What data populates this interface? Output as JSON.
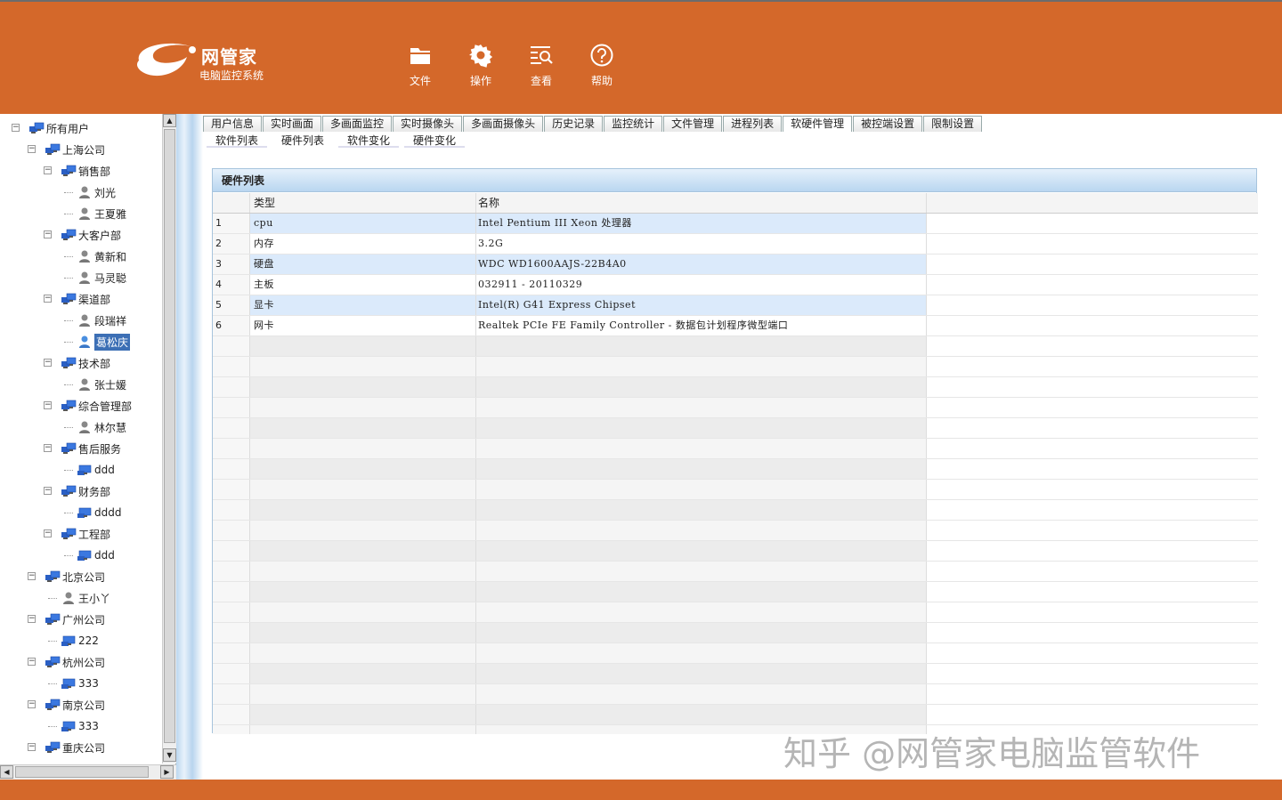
{
  "brand": {
    "name": "网管家",
    "subtitle": "电脑监控系统"
  },
  "toolbar": [
    {
      "label": "文件",
      "icon": "folder-icon"
    },
    {
      "label": "操作",
      "icon": "gear-icon"
    },
    {
      "label": "查看",
      "icon": "view-search-icon"
    },
    {
      "label": "帮助",
      "icon": "help-icon"
    }
  ],
  "tree": [
    {
      "label": "所有用户",
      "type": "group",
      "level": 0,
      "expanded": true
    },
    {
      "label": "上海公司",
      "type": "group",
      "level": 1,
      "expanded": true
    },
    {
      "label": "销售部",
      "type": "group",
      "level": 2,
      "expanded": true
    },
    {
      "label": "刘光",
      "type": "user",
      "level": 3
    },
    {
      "label": "王夏雅",
      "type": "user",
      "level": 3
    },
    {
      "label": "大客户部",
      "type": "group",
      "level": 2,
      "expanded": true
    },
    {
      "label": "黄新和",
      "type": "user",
      "level": 3
    },
    {
      "label": "马灵聪",
      "type": "user",
      "level": 3
    },
    {
      "label": "渠道部",
      "type": "group",
      "level": 2,
      "expanded": true
    },
    {
      "label": "段瑞祥",
      "type": "user",
      "level": 3
    },
    {
      "label": "葛松庆",
      "type": "user",
      "level": 3,
      "selected": true
    },
    {
      "label": "技术部",
      "type": "group",
      "level": 2,
      "expanded": true
    },
    {
      "label": "张士媛",
      "type": "user",
      "level": 3
    },
    {
      "label": "综合管理部",
      "type": "group",
      "level": 2,
      "expanded": true
    },
    {
      "label": "林尔慧",
      "type": "user",
      "level": 3
    },
    {
      "label": "售后服务",
      "type": "group",
      "level": 2,
      "expanded": true
    },
    {
      "label": "ddd",
      "type": "computer",
      "level": 3
    },
    {
      "label": "财务部",
      "type": "group",
      "level": 2,
      "expanded": true
    },
    {
      "label": "dddd",
      "type": "computer",
      "level": 3
    },
    {
      "label": "工程部",
      "type": "group",
      "level": 2,
      "expanded": true
    },
    {
      "label": "ddd",
      "type": "computer",
      "level": 3
    },
    {
      "label": "北京公司",
      "type": "group",
      "level": 1,
      "expanded": true
    },
    {
      "label": "王小丫",
      "type": "user",
      "level": 2
    },
    {
      "label": "广州公司",
      "type": "group",
      "level": 1,
      "expanded": true
    },
    {
      "label": "222",
      "type": "computer",
      "level": 2
    },
    {
      "label": "杭州公司",
      "type": "group",
      "level": 1,
      "expanded": true
    },
    {
      "label": "333",
      "type": "computer",
      "level": 2
    },
    {
      "label": "南京公司",
      "type": "group",
      "level": 1,
      "expanded": true
    },
    {
      "label": "333",
      "type": "computer",
      "level": 2
    },
    {
      "label": "重庆公司",
      "type": "group",
      "level": 1,
      "expanded": true
    }
  ],
  "tabs": [
    "用户信息",
    "实时画面",
    "多画面监控",
    "实时摄像头",
    "多画面摄像头",
    "历史记录",
    "监控统计",
    "文件管理",
    "进程列表",
    "软硬件管理",
    "被控端设置",
    "限制设置"
  ],
  "active_tab": "软硬件管理",
  "subtabs": [
    "软件列表",
    "硬件列表",
    "软件变化",
    "硬件变化"
  ],
  "active_subtab": "硬件列表",
  "panel": {
    "title": "硬件列表",
    "columns": [
      "类型",
      "名称"
    ],
    "rows": [
      {
        "idx": "1",
        "type": "cpu",
        "name": "Intel Pentium III Xeon 处理器"
      },
      {
        "idx": "2",
        "type": "内存",
        "name": "3.2G"
      },
      {
        "idx": "3",
        "type": "硬盘",
        "name": "WDC WD1600AAJS-22B4A0"
      },
      {
        "idx": "4",
        "type": "主板",
        "name": "032911 - 20110329"
      },
      {
        "idx": "5",
        "type": "显卡",
        "name": "Intel(R) G41 Express Chipset"
      },
      {
        "idx": "6",
        "type": "网卡",
        "name": "Realtek PCIe FE Family Controller - 数据包计划程序微型端口"
      }
    ]
  },
  "watermark": "知乎 @网管家电脑监管软件",
  "colors": {
    "header": "#d4682a",
    "selected": "#3c6fb5",
    "row_alt": "#dbeafb"
  }
}
